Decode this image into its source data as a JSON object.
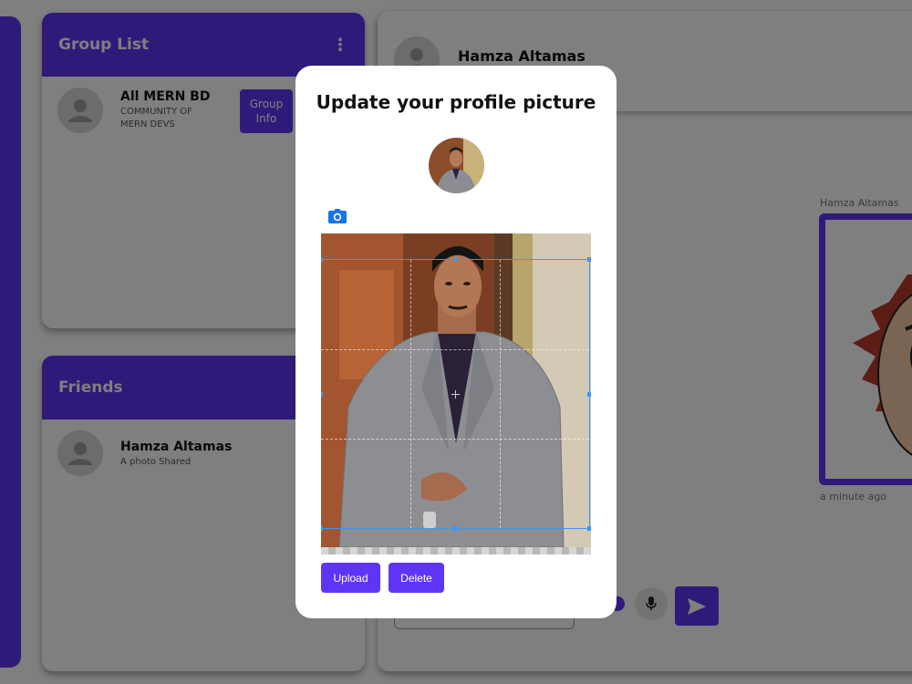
{
  "colors": {
    "accent": "#5f35f5",
    "overlay": "rgba(0,0,0,0.5)"
  },
  "group_list": {
    "title": "Group List",
    "menu_icon": "kebab-menu-icon",
    "items": [
      {
        "name": "All MERN BD",
        "subtitle": "COMMUNITY OF MERN DEVS",
        "button": "Group Info"
      }
    ]
  },
  "friends": {
    "title": "Friends",
    "items": [
      {
        "name": "Hamza Altamas",
        "subtitle": "A photo Shared"
      }
    ]
  },
  "chat": {
    "header_name": "Hamza Altamas",
    "messages": [
      {
        "sender": "Hamza Altamas",
        "type": "image",
        "time": "a minute ago"
      }
    ],
    "icons": {
      "emoji": "emoji-icon",
      "mic": "microphone-icon",
      "send": "send-icon"
    }
  },
  "modal": {
    "title": "Update your profile picture",
    "camera_icon": "camera-icon",
    "upload_label": "Upload",
    "delete_label": "Delete"
  }
}
